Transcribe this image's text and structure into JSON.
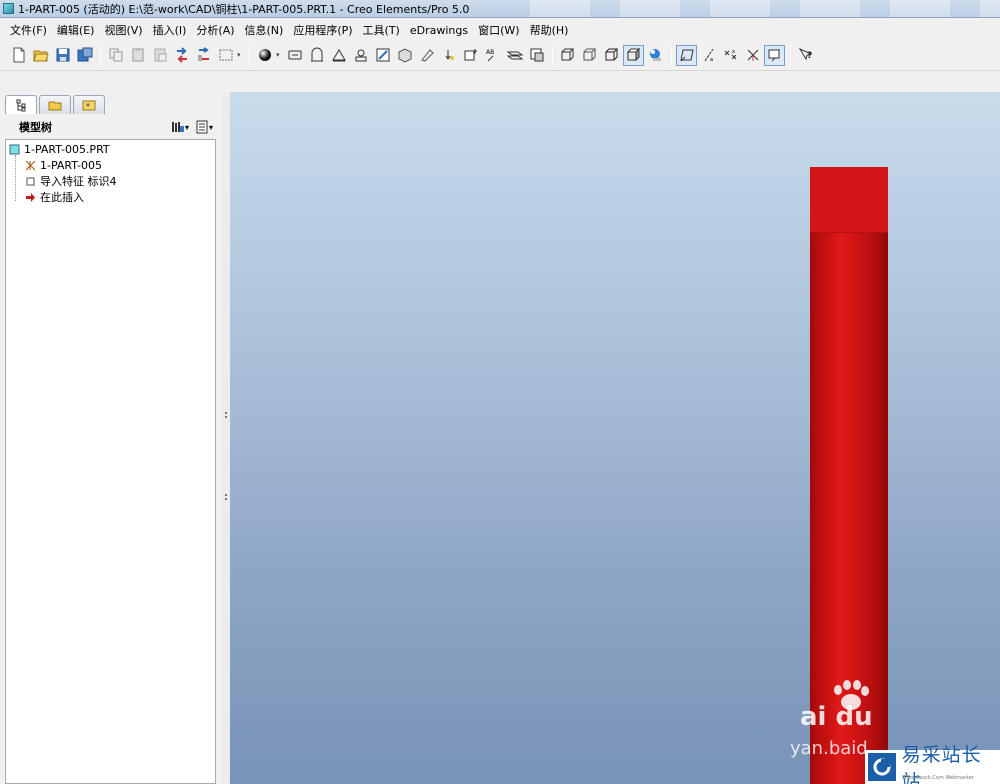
{
  "window": {
    "title": "1-PART-005 (活动的) E:\\范-work\\CAD\\铜柱\\1-PART-005.PRT.1 - Creo Elements/Pro 5.0"
  },
  "menu": [
    "文件(F)",
    "编辑(E)",
    "视图(V)",
    "插入(I)",
    "分析(A)",
    "信息(N)",
    "应用程序(P)",
    "工具(T)",
    "eDrawings",
    "窗口(W)",
    "帮助(H)"
  ],
  "toolbar_icons": [
    "new-file-icon",
    "open-folder-icon",
    "save-icon",
    "save-copy-icon",
    "copy-icon",
    "paste-icon",
    "paste-special-icon",
    "regenerate-icon",
    "regenerate-manager-icon",
    "select-box-icon",
    "shade-sphere-icon",
    "repaint-icon",
    "orient-icon",
    "zoom-in-icon",
    "zoom-out-icon",
    "refit-icon",
    "view-manager-icon",
    "saved-views-icon",
    "layers-icon",
    "spin-center-icon",
    "csys-display-icon",
    "datum-planes-icon",
    "appearance-icon",
    "wireframe-icon",
    "hidden-line-icon",
    "no-hidden-icon",
    "shading-icon",
    "enhanced-realism-icon",
    "datum-plane-display-icon",
    "datum-axis-display-icon",
    "datum-point-display-icon",
    "csys-toggle-icon",
    "annotation-display-icon",
    "whats-this-icon"
  ],
  "model_tree": {
    "title": "模型树",
    "tabs": [
      "model-tree-tab",
      "folder-browser-tab",
      "favorites-tab"
    ],
    "nodes": [
      {
        "label": "1-PART-005.PRT",
        "icon": "part-icon"
      },
      {
        "label": "1-PART-005",
        "icon": "csys-icon"
      },
      {
        "label": "导入特征 标识4",
        "icon": "import-feature-icon"
      },
      {
        "label": "在此插入",
        "icon": "insert-here-arrow-icon"
      }
    ]
  },
  "colors": {
    "part_red": "#d21616",
    "viewport_top": "#c9dcec",
    "viewport_bottom": "#7793b8"
  },
  "watermarks": {
    "baidu": "ai du",
    "baidu_url": "yan.baid",
    "site_name": "易采站长站",
    "site_sub": "Www.Easck.Com Webmaster"
  }
}
